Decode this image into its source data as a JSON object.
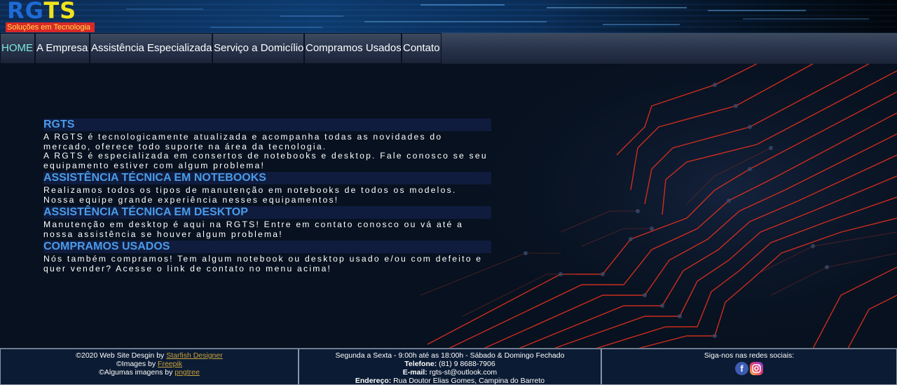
{
  "header": {
    "logo_text": "RGTS",
    "logo_subtitle": "Soluções em Tecnologia"
  },
  "nav": {
    "items": [
      {
        "label": "HOME",
        "active": true
      },
      {
        "label": "A Empresa"
      },
      {
        "label": "Assistência Especializada"
      },
      {
        "label": "Serviço a Domicílio"
      },
      {
        "label": "Compramos Usados"
      },
      {
        "label": "Contato"
      }
    ]
  },
  "content": {
    "sections": [
      {
        "title": "RGTS",
        "paragraphs": [
          "A RGTS é tecnologicamente atualizada e acompanha todas as novidades do mercado, oferece todo suporte na área da tecnologia.",
          "A RGTS é especializada em consertos de notebooks e desktop. Fale conosco se seu equipamento estiver com algum problema!"
        ]
      },
      {
        "title": "ASSISTÊNCIA TÉCNICA EM NOTEBOOKS",
        "paragraphs": [
          "Realizamos todos os tipos de manutenção em notebooks de todos os modelos. Nossa equipe grande experiência nesses equipamentos!"
        ]
      },
      {
        "title": "ASSISTÊNCIA TÉCNICA EM DESKTOP",
        "paragraphs": [
          "Manutenção em desktop é aqui na RGTS! Entre em contato conosco ou vá até a nossa assistência se houver algum problema!"
        ]
      },
      {
        "title": "COMPRAMOS USADOS",
        "paragraphs": [
          "Nós também compramos! Tem algum notebook ou desktop usado e/ou com defeito e quer vender? Acesse o link de contato no menu acima!"
        ]
      }
    ]
  },
  "footer": {
    "credits": {
      "line1_prefix": "©2020 Web Site Desgin by ",
      "line1_link": "Starfish Designer",
      "line2_prefix": "©Images by ",
      "line2_link": "Freepik",
      "line3_prefix": "©Algumas imagens by ",
      "line3_link": "pngtree"
    },
    "contact": {
      "hours": "Segunda a Sexta - 9:00h até as 18:00h - Sábado & Domingo Fechado",
      "phone_label": "Telefone:",
      "phone": "(81) 9 8688-7906",
      "email_label": "E-mail:",
      "email": "rgts-st@outlook.com",
      "address_label": "Endereço:",
      "address": "Rua Doutor Elias Gomes, Campina do Barreto"
    },
    "social": {
      "label": "Siga-nos nas redes sociais:",
      "facebook_glyph": "f",
      "icons": [
        "facebook-icon",
        "instagram-icon"
      ]
    }
  },
  "colors": {
    "background": "#07111f",
    "section_title": "#4a9be8",
    "section_title_bg": "#101c3e",
    "nav_active": "#7fe8e0",
    "link": "#c9a23c",
    "circuit": "#e0301e"
  }
}
